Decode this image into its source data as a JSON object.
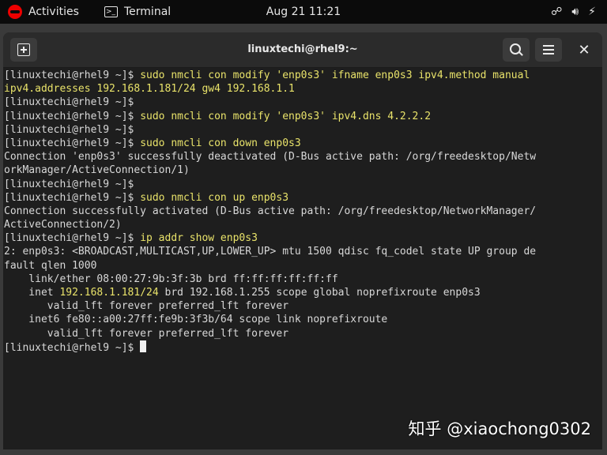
{
  "topbar": {
    "activities": "Activities",
    "app_name": "Terminal",
    "datetime": "Aug 21  11:21"
  },
  "window": {
    "title": "linuxtechi@rhel9:~"
  },
  "terminal": {
    "l0_p": "[linuxtechi@rhel9 ~]$ ",
    "l0_c": "sudo nmcli con modify 'enp0s3' ifname enp0s3 ipv4.method manual",
    "l1_c": "ipv4.addresses 192.168.1.181/24 gw4 192.168.1.1",
    "l2_p": "[linuxtechi@rhel9 ~]$",
    "l3_p": "[linuxtechi@rhel9 ~]$ ",
    "l3_c": "sudo nmcli con modify 'enp0s3' ipv4.dns 4.2.2.2",
    "l4_p": "[linuxtechi@rhel9 ~]$",
    "l5_p": "[linuxtechi@rhel9 ~]$ ",
    "l5_c": "sudo nmcli con down enp0s3",
    "l6": "Connection 'enp0s3' successfully deactivated (D-Bus active path: /org/freedesktop/Netw",
    "l7": "orkManager/ActiveConnection/1)",
    "l8_p": "[linuxtechi@rhel9 ~]$",
    "l9_p": "[linuxtechi@rhel9 ~]$ ",
    "l9_c": "sudo nmcli con up enp0s3",
    "l10": "Connection successfully activated (D-Bus active path: /org/freedesktop/NetworkManager/",
    "l11": "ActiveConnection/2)",
    "l12_p": "[linuxtechi@rhel9 ~]$ ",
    "l12_c": "ip addr show enp0s3",
    "l13": "2: enp0s3: <BROADCAST,MULTICAST,UP,LOWER_UP> mtu 1500 qdisc fq_codel state UP group de",
    "l14": "fault qlen 1000",
    "l15": "    link/ether 08:00:27:9b:3f:3b brd ff:ff:ff:ff:ff:ff",
    "l16_a": "    inet ",
    "l16_ip": "192.168.1.181/24",
    "l16_b": " brd 192.168.1.255 scope global noprefixroute enp0s3",
    "l17": "       valid_lft forever preferred_lft forever",
    "l18": "    inet6 fe80::a00:27ff:fe9b:3f3b/64 scope link noprefixroute",
    "l19": "       valid_lft forever preferred_lft forever",
    "l20_p": "[linuxtechi@rhel9 ~]$ "
  },
  "watermark": "知乎 @xiaochong0302",
  "colors": {
    "command": "#e9e36a",
    "terminal_bg": "#1e1e1e",
    "redhat": "#ee0000"
  }
}
